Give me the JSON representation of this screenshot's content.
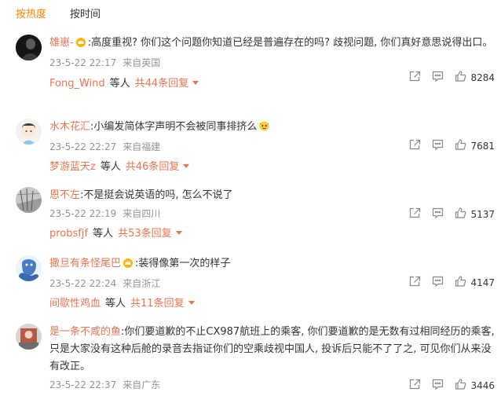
{
  "tabs": [
    {
      "label": "按热度"
    },
    {
      "label": "按时间"
    }
  ],
  "comments": [
    {
      "name": "雄崽-",
      "text": ":高度重视? 你们这个问题你知道已经是普遍存在的吗? 歧视问题, 你们真好意思说得出口。",
      "time": "23-5-22 22:17",
      "location": "来自英国",
      "likes": "8284",
      "reply_user": "Fong_Wind",
      "reply_mid": "等人",
      "reply_total": "共44条回复"
    },
    {
      "name": "水木花汇",
      "text": ":小编发简体字声明不会被同事排挤么",
      "time": "23-5-22 22:27",
      "location": "来自福建",
      "likes": "7681",
      "reply_user": "梦游蓝天z",
      "reply_mid": "等人",
      "reply_total": "共46条回复"
    },
    {
      "name": "恩不左",
      "text": ":不是挺会说英语的吗, 怎么不说了",
      "time": "23-5-22 22:19",
      "location": "来自四川",
      "likes": "5137",
      "reply_user": "probsfjf",
      "reply_mid": "等人",
      "reply_total": "共53条回复"
    },
    {
      "name": "撒旦有条怪尾巴",
      "text": ":装得像第一次的样子",
      "time": "23-5-22 22:24",
      "location": "来自浙江",
      "likes": "4147",
      "reply_user": "间歇性鸡血",
      "reply_mid": "等人",
      "reply_total": "共11条回复"
    },
    {
      "name": "是一条不咸的鱼",
      "text": ":你们要道歉的不止CX987航班上的乘客, 你们要道歉的是无数有过相同经历的乘客, 只是大家没有这种后舱的录音去指证你们的空乘歧视中国人, 投诉后只能不了了之, 可见你们从来没有改正。",
      "time": "23-5-22 22:37",
      "location": "来自广东",
      "likes": "3446"
    }
  ],
  "colors": {
    "accent": "#ff8200",
    "name": "#eb7350",
    "meta": "#939393"
  },
  "icons": [
    "share-icon",
    "comment-icon",
    "thumbs-up-icon",
    "crown-icon",
    "emoji-icon"
  ]
}
